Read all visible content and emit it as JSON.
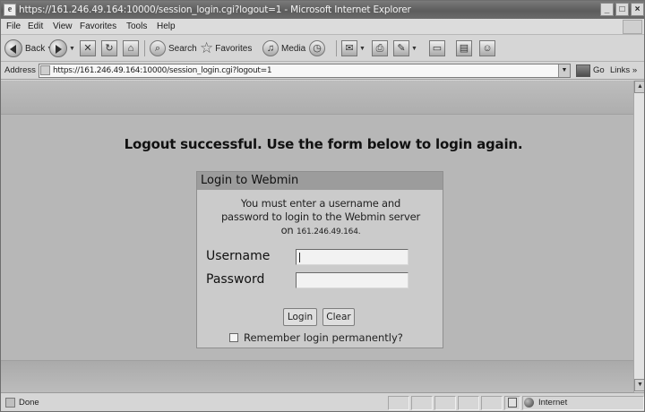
{
  "window": {
    "title": "https://161.246.49.164:10000/session_login.cgi?logout=1 - Microsoft Internet Explorer",
    "controls": [
      "_",
      "□",
      "×"
    ]
  },
  "menubar": {
    "items": [
      "File",
      "Edit",
      "View",
      "Favorites",
      "Tools",
      "Help"
    ]
  },
  "toolbar": {
    "back_label": "Back",
    "search_label": "Search",
    "favorites_label": "Favorites",
    "media_label": "Media"
  },
  "address_bar": {
    "label": "Address",
    "url": "https://161.246.49.164:10000/session_login.cgi?logout=1",
    "go_label": "Go",
    "links_label": "Links »"
  },
  "page": {
    "logout_message": "Logout successful. Use the form below to login again.",
    "login_box": {
      "title": "Login to Webmin",
      "message_line1": "You must enter a username and",
      "message_line2": "password to login to the Webmin server",
      "message_line3_prefix": "on ",
      "server_ip": "161.246.49.164.",
      "username_label": "Username",
      "username_value": "",
      "password_label": "Password",
      "password_value": "",
      "login_button": "Login",
      "clear_button": "Clear",
      "remember_label": "Remember login permanently?",
      "remember_checked": false
    }
  },
  "statusbar": {
    "status_text": "Done",
    "zone_text": "Internet"
  },
  "icons": {
    "back": "back-arrow-icon",
    "forward": "forward-arrow-icon",
    "stop": "stop-icon",
    "refresh": "refresh-icon",
    "home": "home-icon",
    "search": "search-icon",
    "favorites": "star-icon",
    "media": "media-icon",
    "history": "history-icon",
    "mail": "mail-icon",
    "print": "print-icon",
    "edit": "edit-icon",
    "discuss": "discuss-icon",
    "messenger": "messenger-icon",
    "lock": "padlock-icon",
    "zone": "globe-icon"
  }
}
